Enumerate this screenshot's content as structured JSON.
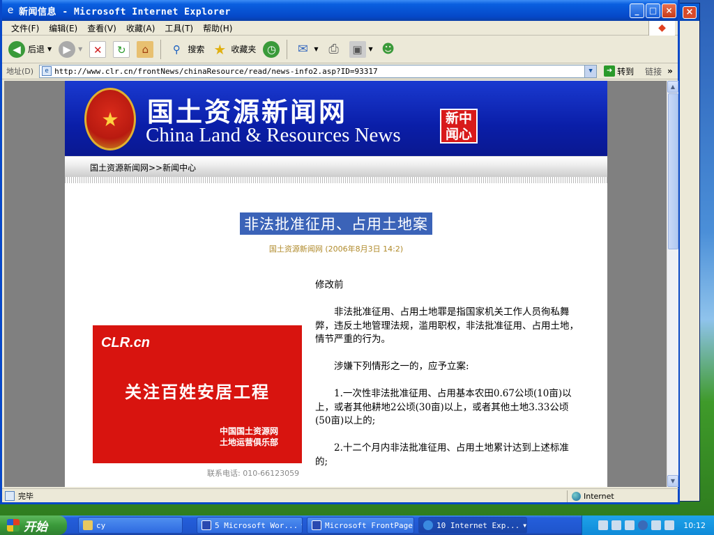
{
  "window": {
    "title": "新闻信息 - Microsoft Internet Explorer",
    "buttons": [
      "_",
      "□",
      "×"
    ]
  },
  "menu": [
    "文件(F)",
    "编辑(E)",
    "查看(V)",
    "收藏(A)",
    "工具(T)",
    "帮助(H)"
  ],
  "toolbar": {
    "back_label": "后退",
    "search_label": "搜索",
    "favorites_label": "收藏夹"
  },
  "address": {
    "label": "地址(D)",
    "url": "http://www.clr.cn/frontNews/chinaResource/read/news-info2.asp?ID=93317",
    "go_label": "转到",
    "links_label": "链接"
  },
  "page": {
    "site_name_cn": "国土资源新闻网",
    "site_name_en": "China Land & Resources News",
    "badge": "新中闻心",
    "breadcrumb": "国土资源新闻网>>新闻中心",
    "article_title": "非法批准征用、占用土地案",
    "article_meta": "国土资源新闻网 (2006年8月3日  14:2)",
    "ad": {
      "logo": "CLR.cn",
      "slogan": "关注百姓安居工程",
      "org_line1": "中国国土资源网",
      "org_line2": "土地运营俱乐部",
      "phone": "联系电话: 010-66123059"
    },
    "paragraphs": [
      "修改前",
      "非法批准征用、占用土地罪是指国家机关工作人员徇私舞弊，违反土地管理法规，滥用职权，非法批准征用、占用土地，情节严重的行为。",
      "涉嫌下列情形之一的，应予立案:",
      "1.一次性非法批准征用、占用基本农田0.67公顷(10亩)以上，或者其他耕地2公顷(30亩)以上，或者其他土地3.33公顷(50亩)以上的;",
      "2.十二个月内非法批准征用、占用土地累计达到上述标准的;"
    ]
  },
  "status": {
    "text": "完毕",
    "zone": "Internet"
  },
  "taskbar": {
    "start_label": "开始",
    "tasks": [
      "cy",
      "5 Microsoft Wor...",
      "Microsoft FrontPage",
      "10 Internet Exp..."
    ],
    "clock": "10:12"
  },
  "colors": {
    "banner_blue": "#0a1ea8",
    "title_highlight": "#3b63b8",
    "ad_red": "#d8140f",
    "meta_gold": "#b08a2a"
  }
}
